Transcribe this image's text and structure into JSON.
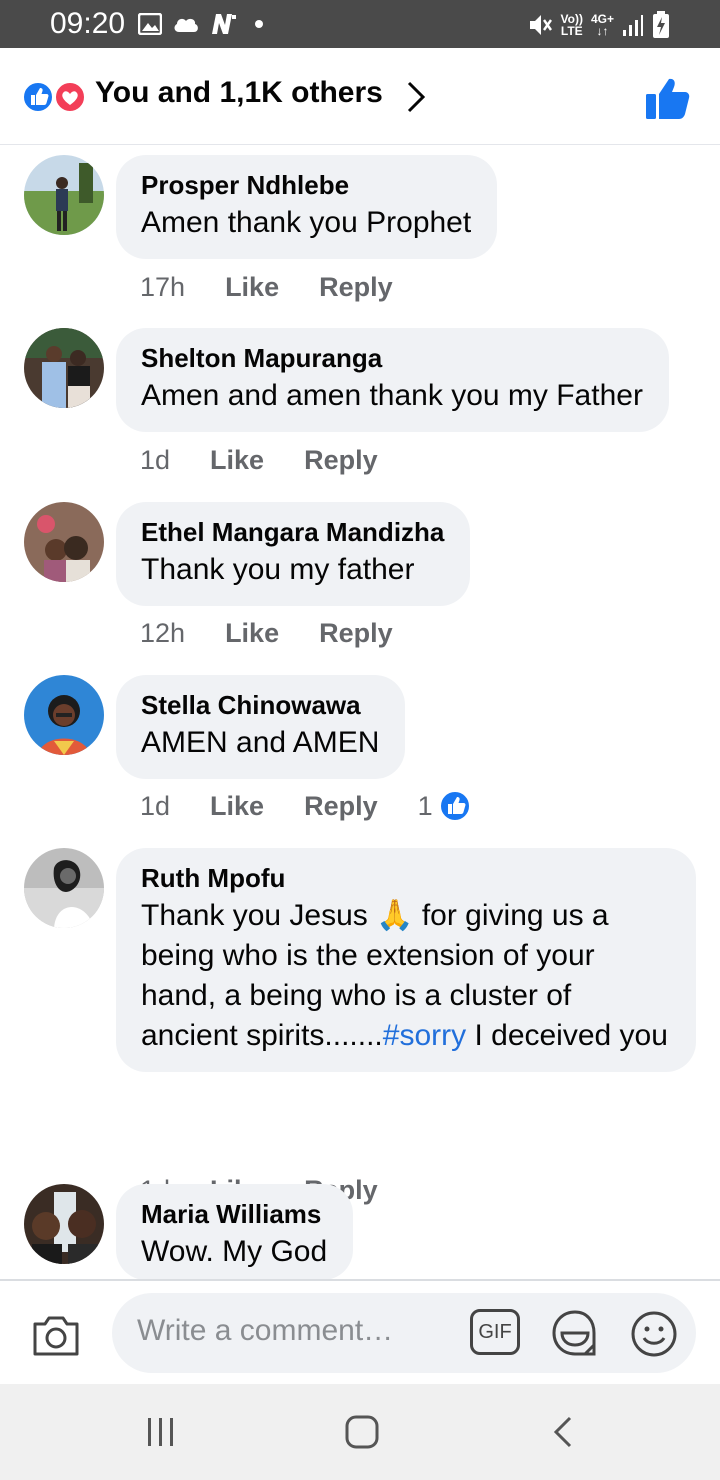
{
  "status_bar": {
    "time": "09:20",
    "left_icons": [
      "image-icon",
      "cloud-icon",
      "n-app-icon",
      "dot-icon"
    ],
    "network_label_top": "Vo))",
    "network_label_bottom": "LTE",
    "network_type": "4G+",
    "right_icons": [
      "mute-icon",
      "signal-icon",
      "battery-charging-icon"
    ]
  },
  "header": {
    "reactions": [
      "like-reaction-icon",
      "love-reaction-icon"
    ],
    "reaction_summary": "You and 1,1K others",
    "like_button_icon": "thumbs-up-icon"
  },
  "comments": [
    {
      "author": "Prosper Ndhlebe",
      "text": "Amen thank you Prophet",
      "time": "17h",
      "like_label": "Like",
      "reply_label": "Reply"
    },
    {
      "author": "Shelton Mapuranga",
      "text": "Amen and amen thank you my Father",
      "time": "1d",
      "like_label": "Like",
      "reply_label": "Reply"
    },
    {
      "author": "Ethel Mangara Mandizha",
      "text": "Thank you my father",
      "time": "12h",
      "like_label": "Like",
      "reply_label": "Reply"
    },
    {
      "author": "Stella Chinowawa",
      "text": "AMEN and AMEN",
      "time": "1d",
      "like_label": "Like",
      "reply_label": "Reply",
      "like_count": "1"
    },
    {
      "author": "Ruth Mpofu",
      "text_before": "Thank you Jesus",
      "emoji": "🙏",
      "text_after": " for giving us a being who is the extension of your hand, a being who is a cluster of ancient spirits.......",
      "hashtag": "#sorry",
      "text_end": " I deceived you",
      "time": "1d",
      "like_label": "Like",
      "reply_label": "Reply"
    },
    {
      "author": "Maria Williams",
      "text": "Wow. My God"
    }
  ],
  "composer": {
    "placeholder": "Write a comment…",
    "camera_icon": "camera-icon",
    "gif_label": "GIF",
    "sticker_icon": "sticker-icon",
    "emoji_icon": "smiley-icon"
  },
  "nav_bar": [
    "recent-apps-icon",
    "home-icon",
    "back-icon"
  ],
  "colors": {
    "accent": "#1877f2",
    "love": "#f33e58",
    "bubble": "#f0f2f5",
    "secondary_text": "#65676b",
    "hashtag": "#216fdb"
  }
}
